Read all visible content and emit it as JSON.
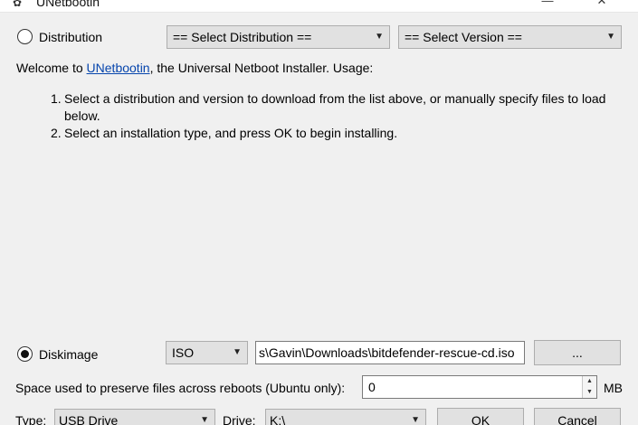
{
  "window": {
    "title": "UNetbootin",
    "app_icon": "unetbootin-icon",
    "controls": {
      "minimize": "—",
      "close": "✕"
    }
  },
  "distribution": {
    "radio_label": "Distribution",
    "selected": false,
    "distro_select": "== Select Distribution ==",
    "version_select": "== Select Version =="
  },
  "welcome": {
    "prefix": "Welcome to ",
    "link": "UNetbootin",
    "suffix": ", the Universal Netboot Installer. Usage:",
    "steps": [
      {
        "num": "1.",
        "text": "Select a distribution and version to download from the list above, or manually specify files to load below."
      },
      {
        "num": "2.",
        "text": "Select an installation type, and press OK to begin installing."
      }
    ]
  },
  "diskimage": {
    "radio_label": "Diskimage",
    "selected": true,
    "format_select": "ISO",
    "path_value": "s\\Gavin\\Downloads\\bitdefender-rescue-cd.iso",
    "browse_label": "..."
  },
  "persistence": {
    "label": "Space used to preserve files across reboots (Ubuntu only):",
    "value": "0",
    "unit": "MB"
  },
  "target": {
    "type_label": "Type:",
    "type_value": "USB Drive",
    "drive_label": "Drive:",
    "drive_value": "K:\\",
    "ok_label": "OK",
    "cancel_label": "Cancel"
  },
  "colors": {
    "link": "#0645ad",
    "background": "#f0f0f0",
    "button": "#e1e1e1"
  }
}
